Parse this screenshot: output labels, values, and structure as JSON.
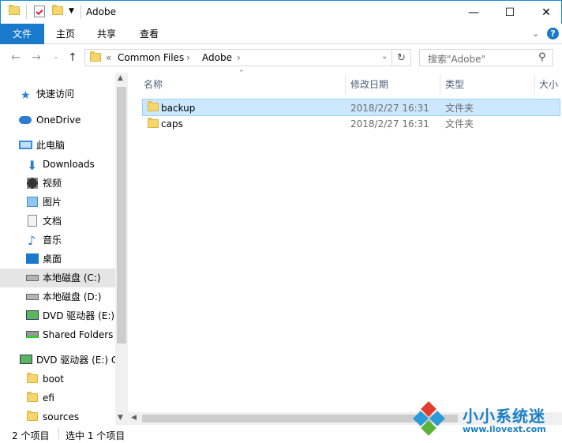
{
  "window": {
    "title": "Adobe",
    "minimize": "—",
    "maximize": "☐",
    "close": "✕"
  },
  "ribbon": {
    "tabs": [
      "文件",
      "主页",
      "共享",
      "查看"
    ],
    "collapse_icon": "chevron-down-icon",
    "help": "?"
  },
  "address": {
    "overflow": "«",
    "crumbs": [
      "Common Files",
      "Adobe"
    ],
    "separator": "›",
    "search_placeholder": "搜索\"Adobe\""
  },
  "nav": {
    "items": [
      {
        "label": "快速访问",
        "icon": "star-icon"
      },
      {
        "label": "OneDrive",
        "icon": "cloud-icon"
      },
      {
        "label": "此电脑",
        "icon": "computer-icon"
      },
      {
        "label": "Downloads",
        "icon": "download-icon"
      },
      {
        "label": "视频",
        "icon": "video-icon"
      },
      {
        "label": "图片",
        "icon": "picture-icon"
      },
      {
        "label": "文档",
        "icon": "document-icon"
      },
      {
        "label": "音乐",
        "icon": "music-icon"
      },
      {
        "label": "桌面",
        "icon": "desktop-icon"
      },
      {
        "label": "本地磁盘 (C:)",
        "icon": "drive-icon"
      },
      {
        "label": "本地磁盘 (D:)",
        "icon": "drive-icon"
      },
      {
        "label": "DVD 驱动器 (E:)",
        "icon": "dvd-icon"
      },
      {
        "label": "Shared Folders",
        "icon": "network-drive-icon"
      },
      {
        "label": "DVD 驱动器 (E:) C",
        "icon": "dvd-icon"
      },
      {
        "label": "boot",
        "icon": "folder-icon"
      },
      {
        "label": "efi",
        "icon": "folder-icon"
      },
      {
        "label": "sources",
        "icon": "folder-icon"
      }
    ]
  },
  "columns": {
    "name": "名称",
    "modified": "修改日期",
    "type": "类型",
    "size": "大小"
  },
  "files": [
    {
      "name": "backup",
      "modified": "2018/2/27 16:31",
      "type": "文件夹"
    },
    {
      "name": "caps",
      "modified": "2018/2/27 16:31",
      "type": "文件夹"
    }
  ],
  "status": {
    "count": "2 个项目",
    "selected": "选中 1 个项目"
  },
  "watermark": {
    "cn": "小小系统迷",
    "url": "www.ilovext.com"
  },
  "colors": {
    "accent": "#1979ca",
    "selection": "#cce8ff",
    "folder": "#f5d66e"
  }
}
